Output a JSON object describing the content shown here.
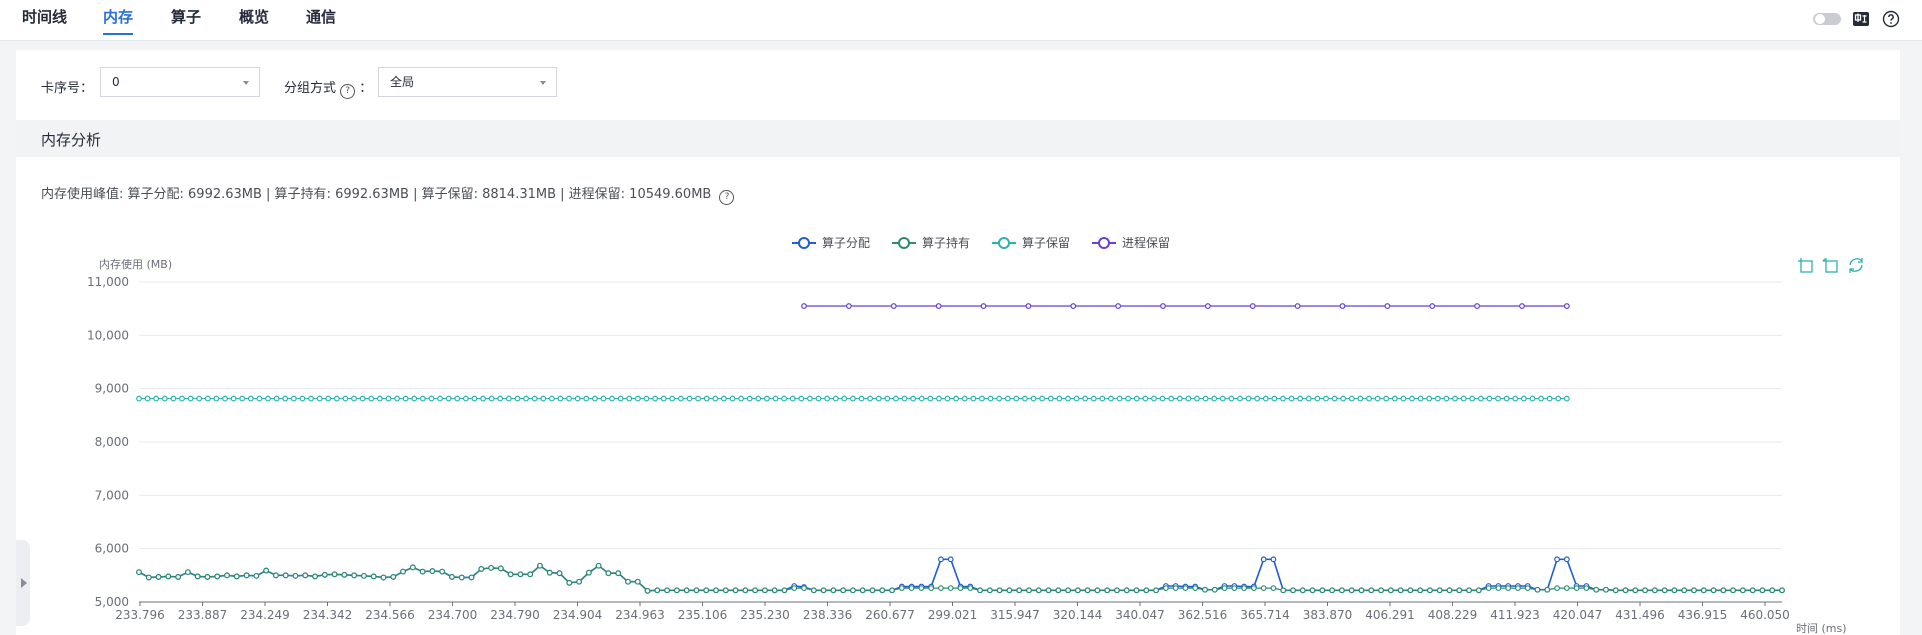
{
  "tabs": [
    {
      "label": "时间线",
      "active": false
    },
    {
      "label": "内存",
      "active": true
    },
    {
      "label": "算子",
      "active": false
    },
    {
      "label": "概览",
      "active": false
    },
    {
      "label": "通信",
      "active": false
    }
  ],
  "top_icons": [
    "toggle-switch-icon",
    "language-icon",
    "help-icon"
  ],
  "filters": {
    "card_label": "卡序号：",
    "card_value": "0",
    "group_label": "分组方式",
    "group_colon": "：",
    "group_value": "全局"
  },
  "section": {
    "title": "内存分析",
    "summary": "内存使用峰值: 算子分配: 6992.63MB | 算子持有: 6992.63MB | 算子保留: 8814.31MB | 进程保留: 10549.60MB"
  },
  "colors": {
    "accent": "#2a6fdb",
    "alloc": "#1f5fd1",
    "hold": "#2e8b6e",
    "reserve": "#2fb1ad",
    "process": "#6a3fd6"
  },
  "chart_data": {
    "type": "line",
    "ylabel": "内存使用 (MB)",
    "xlabel": "时间 (ms)",
    "ylim": [
      5000,
      11000
    ],
    "yticks": [
      5000,
      6000,
      7000,
      8000,
      9000,
      10000,
      11000
    ],
    "ytick_labels": [
      "5,000",
      "6,000",
      "7,000",
      "8,000",
      "9,000",
      "10,000",
      "11,000"
    ],
    "x_tick_labels": [
      "233.796",
      "233.887",
      "234.249",
      "234.342",
      "234.566",
      "234.700",
      "234.790",
      "234.904",
      "234.963",
      "235.106",
      "235.230",
      "238.336",
      "260.677",
      "299.021",
      "315.947",
      "320.144",
      "340.047",
      "362.516",
      "365.714",
      "383.870",
      "406.291",
      "408.229",
      "411.923",
      "420.047",
      "431.496",
      "436.915",
      "460.050"
    ],
    "grid": true,
    "legend_position": "top-center",
    "series": [
      {
        "name": "算子分配",
        "values": [
          5560,
          5460,
          5470,
          5480,
          5470,
          5560,
          5480,
          5470,
          5480,
          5500,
          5480,
          5500,
          5490,
          5590,
          5500,
          5500,
          5490,
          5500,
          5480,
          5510,
          5520,
          5510,
          5500,
          5490,
          5480,
          5460,
          5470,
          5570,
          5650,
          5570,
          5580,
          5570,
          5470,
          5460,
          5460,
          5620,
          5640,
          5630,
          5520,
          5520,
          5520,
          5680,
          5550,
          5540,
          5360,
          5380,
          5550,
          5680,
          5540,
          5540,
          5380,
          5380,
          5210,
          5220,
          5220,
          5220,
          5220,
          5220,
          5220,
          5220,
          5220,
          5220,
          5220,
          5220,
          5220,
          5220,
          5220,
          5300,
          5280,
          5220,
          5220,
          5220,
          5220,
          5220,
          5220,
          5220,
          5220,
          5220,
          5290,
          5290,
          5290,
          5290,
          5800,
          5800,
          5290,
          5290,
          5220,
          5220,
          5220,
          5220,
          5220,
          5220,
          5220,
          5220,
          5220,
          5220,
          5220,
          5220,
          5220,
          5220,
          5220,
          5220,
          5220,
          5220,
          5220,
          5300,
          5300,
          5290,
          5290,
          5230,
          5230,
          5300,
          5300,
          5290,
          5290,
          5800,
          5800,
          5220,
          5220,
          5220,
          5220,
          5220,
          5220,
          5220,
          5220,
          5220,
          5220,
          5220,
          5220,
          5220,
          5220,
          5220,
          5220,
          5220,
          5220,
          5220,
          5220,
          5220,
          5300,
          5300,
          5300,
          5300,
          5300,
          5230,
          5230,
          5800,
          5800,
          5300,
          5300,
          5230,
          5230,
          5220,
          5220,
          5220,
          5220,
          5220,
          5220,
          5220,
          5220,
          5220,
          5220,
          5220,
          5220,
          5220,
          5220,
          5220,
          5220,
          5220,
          5220
        ]
      },
      {
        "name": "算子持有",
        "values": [
          5560,
          5460,
          5470,
          5480,
          5470,
          5560,
          5480,
          5470,
          5480,
          5500,
          5480,
          5500,
          5490,
          5590,
          5500,
          5500,
          5490,
          5500,
          5480,
          5510,
          5520,
          5510,
          5500,
          5490,
          5480,
          5460,
          5470,
          5570,
          5650,
          5570,
          5580,
          5570,
          5470,
          5460,
          5460,
          5620,
          5640,
          5630,
          5520,
          5520,
          5520,
          5680,
          5550,
          5540,
          5360,
          5380,
          5550,
          5680,
          5540,
          5540,
          5380,
          5380,
          5210,
          5220,
          5220,
          5220,
          5220,
          5220,
          5220,
          5220,
          5220,
          5220,
          5220,
          5220,
          5220,
          5220,
          5220,
          5260,
          5260,
          5220,
          5220,
          5220,
          5220,
          5220,
          5220,
          5220,
          5220,
          5220,
          5260,
          5260,
          5260,
          5260,
          5260,
          5260,
          5260,
          5260,
          5220,
          5220,
          5220,
          5220,
          5220,
          5220,
          5220,
          5220,
          5220,
          5220,
          5220,
          5220,
          5220,
          5220,
          5220,
          5220,
          5220,
          5220,
          5220,
          5260,
          5260,
          5260,
          5260,
          5230,
          5230,
          5260,
          5260,
          5260,
          5260,
          5260,
          5260,
          5220,
          5220,
          5220,
          5220,
          5220,
          5220,
          5220,
          5220,
          5220,
          5220,
          5220,
          5220,
          5220,
          5220,
          5220,
          5220,
          5220,
          5220,
          5220,
          5220,
          5220,
          5260,
          5260,
          5260,
          5260,
          5260,
          5230,
          5230,
          5260,
          5260,
          5260,
          5260,
          5230,
          5230,
          5220,
          5220,
          5220,
          5220,
          5220,
          5220,
          5220,
          5220,
          5220,
          5220,
          5220,
          5220,
          5220,
          5220,
          5220,
          5220,
          5220,
          5220
        ]
      },
      {
        "name": "算子保留",
        "values": [
          8814,
          8814,
          8814,
          8814,
          8814,
          8814,
          8814,
          8814,
          8814,
          8814,
          8814,
          8814,
          8814,
          8814,
          8814,
          8814,
          8814,
          8814,
          8814,
          8814,
          8814,
          8814,
          8814,
          8814,
          8814,
          8814,
          8814,
          8814,
          8814,
          8814,
          8814,
          8814,
          8814,
          8814,
          8814,
          8814,
          8814,
          8814,
          8814,
          8814,
          8814,
          8814,
          8814,
          8814,
          8814,
          8814,
          8814,
          8814,
          8814,
          8814,
          8814,
          8814,
          8814,
          8814,
          8814,
          8814,
          8814,
          8814,
          8814,
          8814,
          8814,
          8814,
          8814,
          8814,
          8814,
          8814,
          8814,
          8814,
          8814,
          8814,
          8814,
          8814,
          8814,
          8814,
          8814,
          8814,
          8814,
          8814,
          8814,
          8814,
          8814,
          8814,
          8814,
          8814,
          8814,
          8814,
          8814,
          8814,
          8814,
          8814,
          8814,
          8814,
          8814,
          8814,
          8814,
          8814,
          8814,
          8814,
          8814,
          8814,
          8814,
          8814,
          8814,
          8814,
          8814,
          8814,
          8814,
          8814,
          8814,
          8814,
          8814,
          8814,
          8814,
          8814,
          8814,
          8814,
          8814,
          8814,
          8814,
          8814,
          8814,
          8814,
          8814,
          8814,
          8814,
          8814,
          8814,
          8814,
          8814,
          8814,
          8814,
          8814,
          8814,
          8814,
          8814,
          8814,
          8814,
          8814,
          8814,
          8814,
          8814,
          8814,
          8814,
          8814,
          8814,
          8814,
          8814,
          8814,
          8814,
          8814,
          8814,
          8814,
          8814,
          8814,
          8814,
          8814,
          8814,
          8814,
          8814,
          8814,
          8814,
          8814,
          8814,
          8814,
          8814,
          8814,
          8814
        ]
      },
      {
        "name": "进程保留",
        "start_index": 68,
        "points_every": 1,
        "values": [
          10549.6,
          10549.6,
          10549.6,
          10549.6,
          10549.6,
          10549.6,
          10549.6,
          10549.6,
          10549.6,
          10549.6,
          10549.6,
          10549.6,
          10549.6,
          10549.6,
          10549.6,
          10549.6,
          10549.6,
          10549.6
        ]
      }
    ]
  }
}
